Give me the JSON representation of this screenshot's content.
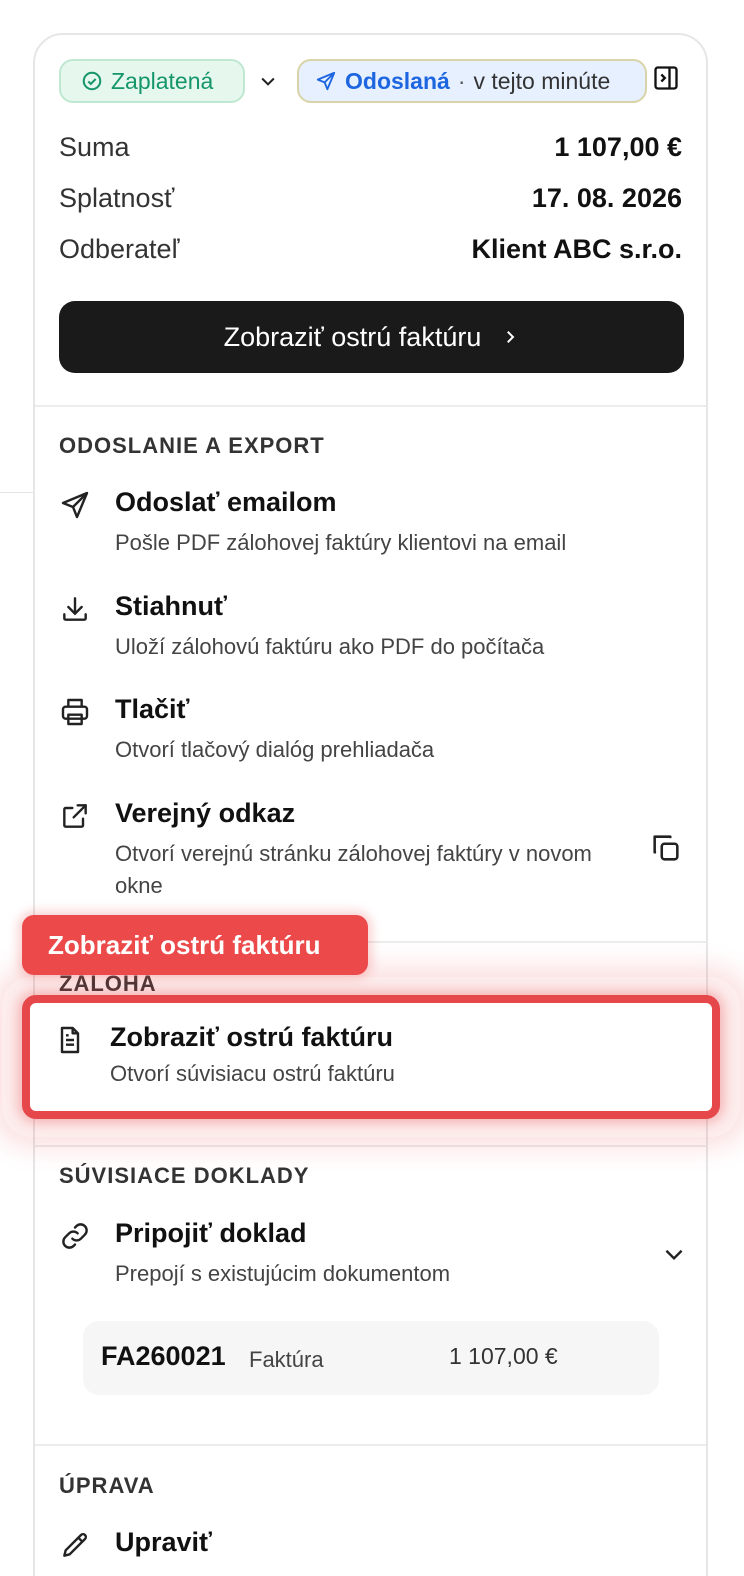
{
  "header": {
    "status_paid": "Zaplatená",
    "status_sent": "Odoslaná",
    "status_sent_separator": "·",
    "status_sent_time": "v tejto minúte"
  },
  "summary": [
    {
      "label": "Suma",
      "value": "1 107,00 €"
    },
    {
      "label": "Splatnosť",
      "value": "17. 08. 2026"
    },
    {
      "label": "Odberateľ",
      "value": "Klient ABC s.r.o."
    }
  ],
  "cta": {
    "label": "Zobraziť ostrú faktúru"
  },
  "sections": {
    "send_export": {
      "title": "ODOSLANIE A EXPORT",
      "items": [
        {
          "title": "Odoslať emailom",
          "desc": "Pošle PDF zálohovej faktúry klientovi na email",
          "icon": "send-icon"
        },
        {
          "title": "Stiahnuť",
          "desc": "Uloží zálohovú faktúru ako PDF do počítača",
          "icon": "download-icon"
        },
        {
          "title": "Tlačiť",
          "desc": "Otvorí tlačový dialóg prehliadača",
          "icon": "printer-icon"
        },
        {
          "title": "Verejný odkaz",
          "desc": "Otvorí verejnú stránku zálohovej faktúry v novom okne",
          "icon": "external-link-icon"
        }
      ]
    },
    "zaloha": {
      "title": "ZÁLOHA",
      "items": [
        {
          "title": "Zobraziť ostrú faktúru",
          "desc": "Otvorí súvisiacu ostrú faktúru",
          "icon": "document-icon"
        }
      ]
    },
    "related": {
      "title": "SÚVISIACE DOKLADY",
      "items": [
        {
          "title": "Pripojiť doklad",
          "desc": "Prepojí s existujúcim dokumentom",
          "icon": "link-icon"
        }
      ],
      "documents": [
        {
          "number": "FA260021",
          "type": "Faktúra",
          "amount": "1 107,00 €"
        }
      ]
    },
    "edit": {
      "title": "ÚPRAVA",
      "items": [
        {
          "title": "Upraviť",
          "icon": "pencil-icon"
        }
      ]
    }
  },
  "highlight": {
    "tag_label": "Zobraziť ostrú faktúru",
    "color": "#e6474a"
  }
}
